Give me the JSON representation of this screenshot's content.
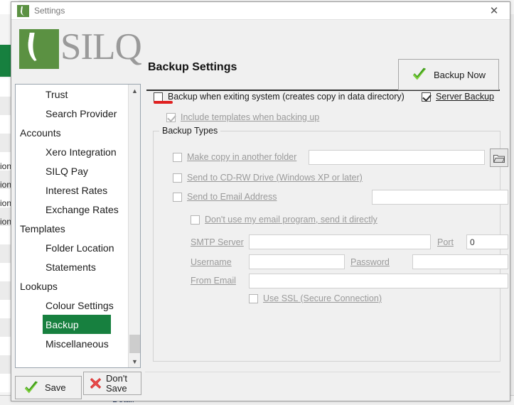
{
  "background": {
    "fragments": [
      "ion",
      "ion",
      "ion",
      "ion"
    ],
    "detail_label": "Detail"
  },
  "window": {
    "title": "Settings",
    "icon": "silq-logo-icon",
    "close_icon": "close-icon"
  },
  "header": {
    "logo_text": "SILQ",
    "page_title": "Backup Settings",
    "backup_now": {
      "label": "Backup Now",
      "icon": "green-check-icon"
    }
  },
  "sidebar": {
    "items": [
      {
        "label": "Trust",
        "level": "child",
        "selected": false
      },
      {
        "label": "Search Provider",
        "level": "child",
        "selected": false
      },
      {
        "label": "Accounts",
        "level": "group",
        "selected": false
      },
      {
        "label": "Xero Integration",
        "level": "child",
        "selected": false
      },
      {
        "label": "SILQ Pay",
        "level": "child",
        "selected": false
      },
      {
        "label": "Interest Rates",
        "level": "child",
        "selected": false
      },
      {
        "label": "Exchange Rates",
        "level": "child",
        "selected": false
      },
      {
        "label": "Templates",
        "level": "group",
        "selected": false
      },
      {
        "label": "Folder Location",
        "level": "child",
        "selected": false
      },
      {
        "label": "Statements",
        "level": "child",
        "selected": false
      },
      {
        "label": "Lookups",
        "level": "group",
        "selected": false
      },
      {
        "label": "Colour Settings",
        "level": "child",
        "selected": false
      },
      {
        "label": "Backup",
        "level": "child",
        "selected": true
      },
      {
        "label": "Miscellaneous",
        "level": "child",
        "selected": false
      }
    ],
    "scrollbar": {
      "up_icon": "chevron-up-icon",
      "down_icon": "chevron-down-icon"
    }
  },
  "footer": {
    "save": {
      "label": "Save",
      "icon": "green-check-icon"
    },
    "dont_save": {
      "label_line1": "Don't",
      "label_line2": "Save",
      "icon": "red-cross-icon"
    }
  },
  "main": {
    "backup_on_exit": {
      "label": "Backup when exiting system (creates copy in data directory)",
      "checked": false,
      "enabled": true
    },
    "server_backup": {
      "label": "Server Backup",
      "checked": true,
      "enabled": true
    },
    "include_templates": {
      "label": "Include templates when backing up",
      "checked": true,
      "enabled": false
    },
    "backup_types": {
      "title": "Backup Types",
      "make_copy": {
        "label": "Make copy in another folder",
        "checked": false,
        "enabled": false,
        "path_value": "",
        "path_placeholder": "",
        "browse_icon": "folder-icon"
      },
      "send_cdrw": {
        "label": "Send to CD-RW Drive (Windows XP or later)",
        "checked": false,
        "enabled": false
      },
      "send_email": {
        "label": "Send to Email Address",
        "checked": false,
        "enabled": false,
        "email_value": "",
        "email_placeholder": ""
      },
      "send_directly": {
        "label": "Don't use my email program, send it directly",
        "checked": false,
        "enabled": false
      },
      "smtp_server": {
        "label": "SMTP Server",
        "value": "",
        "placeholder": ""
      },
      "port": {
        "label": "Port",
        "value": "0",
        "placeholder": ""
      },
      "username": {
        "label": "Username",
        "value": "",
        "placeholder": ""
      },
      "password": {
        "label": "Password",
        "value": "",
        "placeholder": ""
      },
      "from_email": {
        "label": "From Email",
        "value": "",
        "placeholder": ""
      },
      "use_ssl": {
        "label": "Use SSL (Secure Connection)",
        "checked": false,
        "enabled": false
      }
    }
  },
  "colors": {
    "brand_green": "#5b9142",
    "selection_green": "#17803f",
    "annotation_red": "#e02020",
    "window_bg": "#f0f0f0"
  }
}
